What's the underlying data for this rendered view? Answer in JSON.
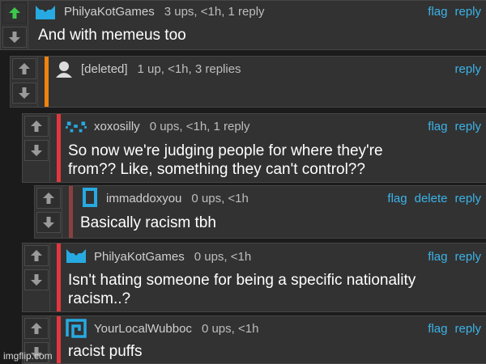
{
  "comments": [
    {
      "user": "PhilyaKotGames",
      "meta": "3 ups, <1h, 1 reply",
      "actions": [
        "flag",
        "reply"
      ],
      "text": "And with memeus too",
      "upvoted": true
    },
    {
      "user": "[deleted]",
      "meta": "1 up, <1h, 3 replies",
      "actions": [
        "reply"
      ],
      "text": ""
    },
    {
      "user": "xoxosilly",
      "meta": "0 ups, <1h, 1 reply",
      "actions": [
        "flag",
        "reply"
      ],
      "text_lines": [
        "So now we're judging people for where they're",
        "from?? Like, something they can't control??"
      ]
    },
    {
      "user": "immaddoxyou",
      "meta": "0 ups, <1h",
      "actions": [
        "flag",
        "delete",
        "reply"
      ],
      "text": "Basically racism tbh"
    },
    {
      "user": "PhilyaKotGames",
      "meta": "0 ups, <1h",
      "actions": [
        "flag",
        "reply"
      ],
      "text_lines": [
        "Isn't hating someone for being a specific nationality",
        "racism..?"
      ]
    },
    {
      "user": "YourLocalWubboc",
      "meta": "0 ups, <1h",
      "actions": [
        "flag",
        "reply"
      ],
      "text": "racist puffs"
    }
  ],
  "colors": {
    "accent_blue": "#3bb3e8",
    "orange": "#f0820f",
    "red": "#e2373c",
    "muted_red": "#8a4040",
    "upvote_green": "#3cc84a"
  },
  "icons": {
    "upvote": "up-arrow-icon",
    "downvote": "down-arrow-icon"
  },
  "watermark": "imgflip.com"
}
